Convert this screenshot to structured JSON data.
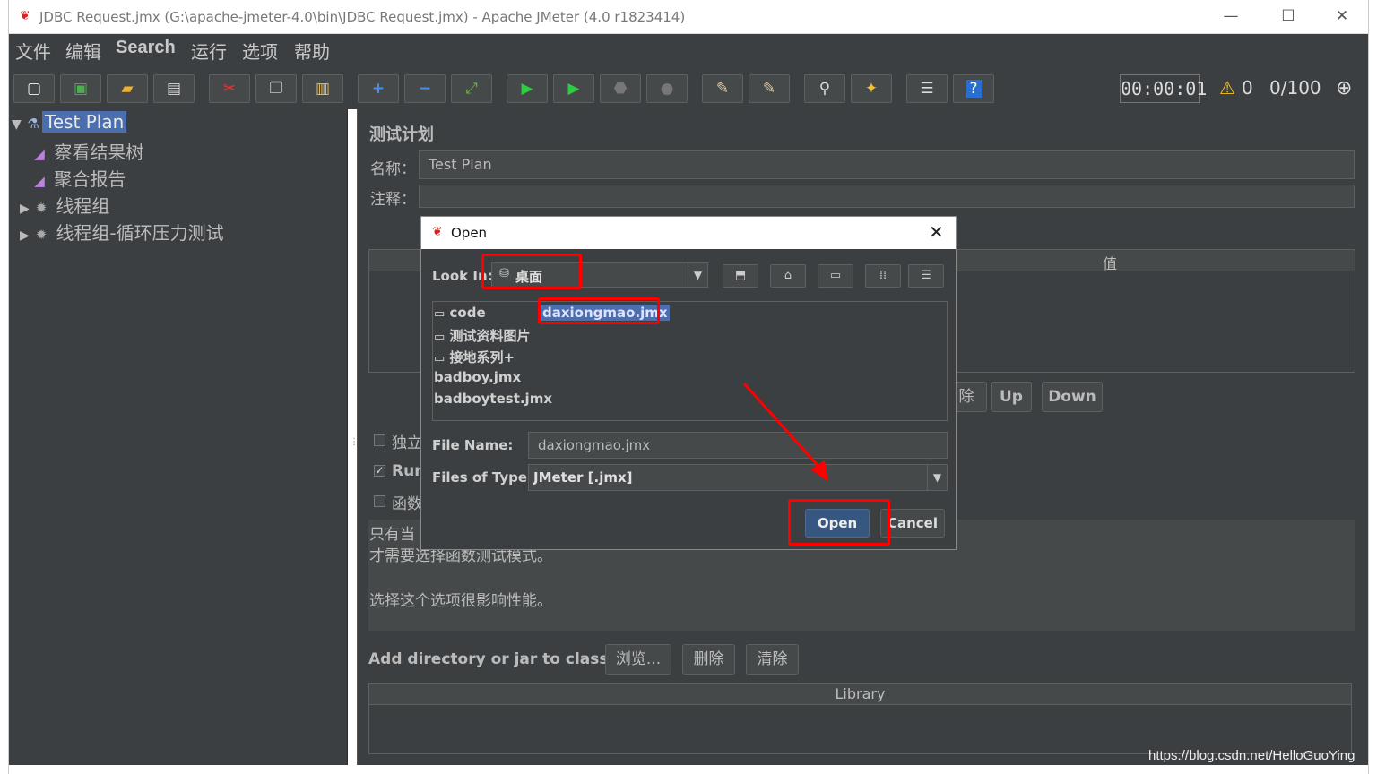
{
  "window": {
    "title": "JDBC Request.jmx (G:\\apache-jmeter-4.0\\bin\\JDBC Request.jmx) - Apache JMeter (4.0 r1823414)",
    "min": "—",
    "max": "☐",
    "close": "✕"
  },
  "menu": [
    "文件",
    "编辑",
    "Search",
    "运行",
    "选项",
    "帮助"
  ],
  "toolbar": {
    "timer": "00:00:01",
    "warnings": "0",
    "threads": "0/100",
    "icons": [
      "new-icon",
      "templates-icon",
      "open-icon",
      "save-icon",
      "cut-icon",
      "copy-icon",
      "paste-icon",
      "expand-icon",
      "collapse-icon",
      "toggle-icon",
      "start-icon",
      "start-no-pause-icon",
      "stop-icon",
      "shutdown-icon",
      "clear-icon",
      "clear-all-icon",
      "search-icon",
      "reset-search-icon",
      "function-helper-icon",
      "help-icon",
      "remote-icon"
    ]
  },
  "tree": {
    "items": [
      {
        "label": "Test Plan",
        "arrow": "▼",
        "icon": "test-plan-icon"
      },
      {
        "label": "察看结果树",
        "arrow": "",
        "icon": "listener-icon"
      },
      {
        "label": "聚合报告",
        "arrow": "",
        "icon": "listener-icon"
      },
      {
        "label": "线程组",
        "arrow": "▶",
        "icon": "thread-group-icon"
      },
      {
        "label": "线程组-循环压力测试",
        "arrow": "▶",
        "icon": "thread-group-icon"
      }
    ]
  },
  "panel": {
    "heading": "测试计划",
    "name_label": "名称：",
    "name_value": "Test Plan",
    "comment_label": "注释：",
    "table_header_value": "值",
    "btn_delete_partial": "除",
    "btn_up": "Up",
    "btn_down": "Down",
    "chk1_label": "独立",
    "chk2_label": "Run",
    "chk3_label": "函数",
    "desc_line1": "只有当",
    "desc_line2": "才需要选择函数测试模式。",
    "desc_line3": "选择这个选项很影响性能。",
    "classpath_label": "Add directory or jar to classpath",
    "btn_browse": "浏览...",
    "btn_remove": "删除",
    "btn_clear": "清除",
    "library_header": "Library"
  },
  "dialog": {
    "title": "Open",
    "look_in_label": "Look In:",
    "look_in_value": "桌面",
    "files": [
      {
        "name": "code",
        "folder": true
      },
      {
        "name": "测试资料图片",
        "folder": true
      },
      {
        "name": "接地系列+",
        "folder": true
      },
      {
        "name": "badboy.jmx",
        "folder": false
      },
      {
        "name": "badboytest.jmx",
        "folder": false
      }
    ],
    "selected_file": "daxiongmao.jmx",
    "file_name_label": "File Name:",
    "file_name_value": "daxiongmao.jmx",
    "files_of_type_label": "Files of Type:",
    "files_of_type_value": "JMeter [.jmx]",
    "open_button": "Open",
    "cancel_button": "Cancel"
  },
  "watermark": "https://blog.csdn.net/HelloGuoYing",
  "colors": {
    "annotation": "#ff0000",
    "selection": "#4b6eaf",
    "background": "#3c3f41"
  }
}
